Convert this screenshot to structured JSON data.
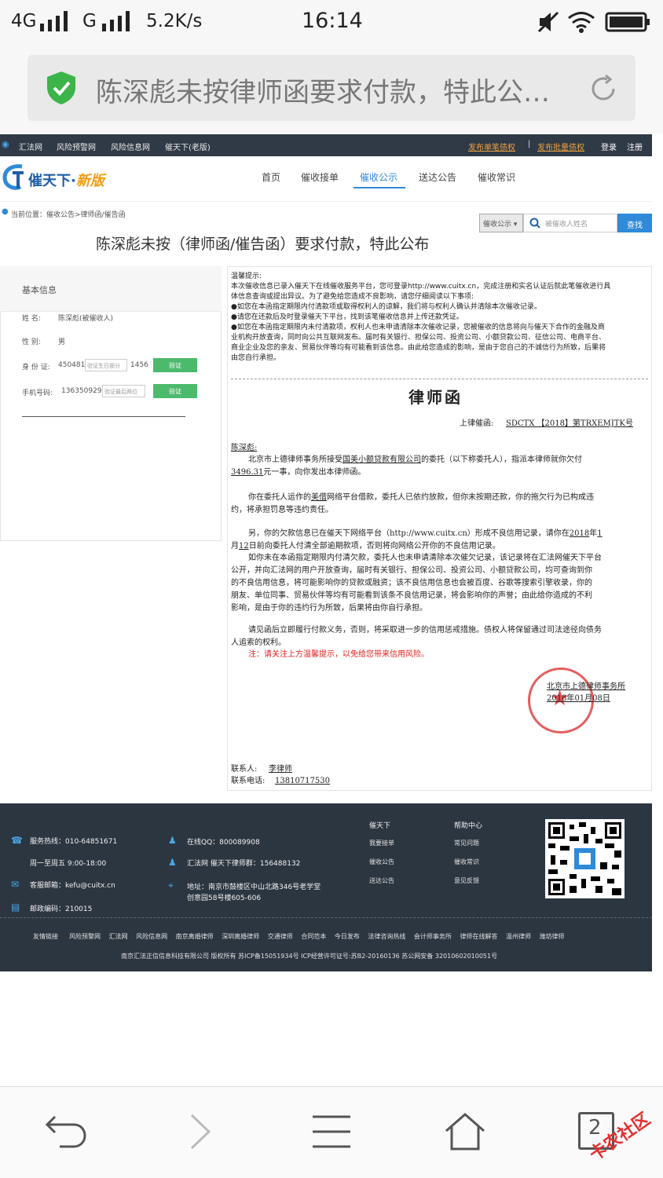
{
  "status_bar": {
    "network1": "4G",
    "network2": "G",
    "speed": "5.2K/s",
    "time": "16:14"
  },
  "url_bar": {
    "text": "陈深彪未按律师函要求付款，特此公…"
  },
  "site_top": {
    "links": [
      "汇法网",
      "风险预警网",
      "风险信息网",
      "催天下(老版)"
    ],
    "publish_single": "发布单笔债权",
    "publish_batch": "发布批量债权",
    "login": "登录",
    "register": "注册",
    "separator": "|"
  },
  "header": {
    "logo_main": "催天下·",
    "logo_new": "新版",
    "nav": [
      "首页",
      "催收接单",
      "催收公示",
      "送达公告",
      "催收常识"
    ]
  },
  "breadcrumb": "当前位置：催收公告>律师函/催告函",
  "search": {
    "select": "催收公示 ▾",
    "placeholder": "被催收人姓名",
    "button": "查找"
  },
  "page_title": "陈深彪未按（律师函/催告函）要求付款，特此公布",
  "basic_info": {
    "title": "基本信息",
    "name_label": "姓    名:",
    "name_value": "陈深彪(被催收人)",
    "gender_label": "性    别:",
    "gender_value": "男",
    "id_label": "身 份 证:",
    "id_prefix": "450481",
    "id_mid_placeholder": "验证生日部分",
    "id_suffix": "1456",
    "phone_label": "手机号码:",
    "phone_prefix": "136350929",
    "phone_placeholder": "验证最后两位",
    "verify": "验证"
  },
  "notice": {
    "heading": "温馨提示:",
    "lines": [
      "本次催收信息已录入催天下在线催收服务平台，您可登录http://www.cuitx.cn，完成注册和实名认证后就此笔催收进行具",
      "体信息查询或提出异议。为了避免给您造成不良影响，请您仔细阅读以下事项:",
      "●如您在本函指定期限内付清款项或取得权利人的谅解，我们将与权利人确认并清除本次催收记录。",
      "●请您在还款后及时登录催天下平台，找到该笔催收信息并上传还款凭证。",
      "●如您在本函指定期限内未付清款项，权利人也未申请清除本次催收记录，您被催收的信息将向与催天下合作的金融及商",
      "业机构开放查询，同时向公共互联网发布。届时有关银行、担保公司、投资公司、小额贷款公司、征信公司、电商平台、",
      "商业企业及您的亲友、贸易伙伴等均有可能看到该信息。由此给您造成的影响，是由于您自己的不诚信行为所致，后果将",
      "由您自行承担。"
    ]
  },
  "letter": {
    "title": "律师函",
    "ref_label": "上律催函:",
    "ref_value": "SDCTX 【2018】第TRXEMJTK号",
    "addressee": "陈深彪:",
    "p1a": "北京市上德律师事务所接受",
    "p1_company": "国美小额贷款有限公司",
    "p1b": "的委托（以下称委托人），指派本律师就你欠付",
    "p1_amount": "3496.31",
    "p1c": "元一事，向你发出本律师函。",
    "p2a": "你在委托人运作的",
    "p2_platform": "美借",
    "p2b": "网络平台借款，委托人已依约放款，但你未按期还款，你的拖欠行为已构成违",
    "p2c": "约，将承担罚息等违约责任。",
    "p3a": "另，你的欠款信息已在催天下网络平台（http://www.cuitx.cn）形成不良信用记录，请你在",
    "p3_year": "2018",
    "p3_year_suffix": "年",
    "p3_month": "1",
    "p3_month_suffix": "月",
    "p3_day": "12",
    "p3b": "日前向委托人付清全部逾期款项，否则将向网络公开你的不良信用记录。",
    "p4_lines": [
      "如你未在本函指定期限内付清欠款，委托人也未申请清除本次催欠记录，该记录将在汇法网催天下平台",
      "公开，并向汇法网的用户开放查询，届时有关银行、担保公司、投资公司、小额贷款公司，均可查询到你",
      "的不良信用信息，将可能影响你的贷款或融资；该不良信用信息也会被百度、谷歌等搜索引擎收录，你的",
      "朋友、单位同事、贸易伙伴等均有可能看到该条不良信用记录，将会影响你的声誉；由此给你造成的不利",
      "影响，是由于你的违约行为所致，后果将由你自行承担。"
    ],
    "p5a": "请见函后立即履行付款义务，否则，将采取进一步的信用惩戒措施。债权人将保留通过司法途径向债务",
    "p5b": "人追索的权利。",
    "warning": "注：请关注上方温馨提示，以免给您带来信用风险。",
    "firm": "北京市上德律师事务所",
    "date": "2018年01月08日",
    "contact_label": "联系人:",
    "contact_value": "李律师",
    "phone_label": "联系电话:",
    "phone_value": "13810717530"
  },
  "footer": {
    "hotline": "服务热线：010-64851671",
    "hours": "周一至周五 9:00-18:00",
    "email": "客服邮箱：kefu@cuitx.cn",
    "zipcode": "邮政编码：210015",
    "qq": "在线QQ：800089908",
    "group": "汇法网 催天下律师群：156488132",
    "address1": "地址：南京市鼓楼区中山北路346号老学堂",
    "address2": "创意园58号楼605-606",
    "col1_title": "催天下",
    "col1": [
      "我要接单",
      "催收公告",
      "送达公告"
    ],
    "col2_title": "帮助中心",
    "col2": [
      "常见问题",
      "催收常识",
      "意见反馈"
    ],
    "links_label": "友情链接",
    "links": [
      "风险预警网",
      "汇法网",
      "风险信息网",
      "南京离婚律师",
      "深圳离婚律师",
      "交通律师",
      "合同范本",
      "今日发布",
      "法律咨询热线",
      "会计师事务所",
      "律师在线解答",
      "温州律师",
      "潍坊律师"
    ],
    "copyright": "南京汇法正信信息科技有限公司 版权所有 苏ICP备15051934号 ICP经营许可证号:苏B2-20160136 苏公网安备 32010602010051号"
  },
  "bottom_nav": {
    "tab_count": "2"
  },
  "watermark": "卡农社区"
}
